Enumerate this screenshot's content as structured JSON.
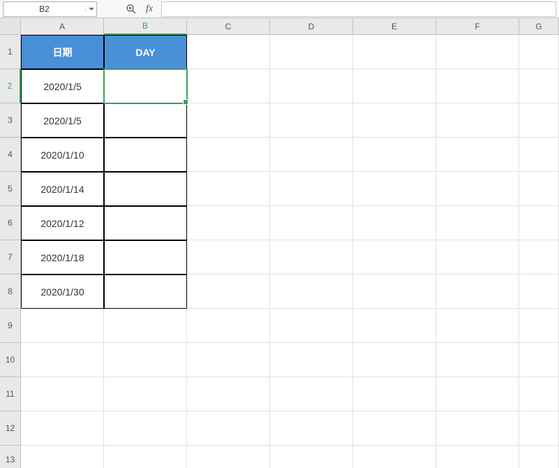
{
  "formula_bar": {
    "cell_ref": "B2",
    "fx_label": "fx",
    "formula_value": ""
  },
  "columns": [
    "A",
    "B",
    "C",
    "D",
    "E",
    "F",
    "G"
  ],
  "row_numbers": [
    "1",
    "2",
    "3",
    "4",
    "5",
    "6",
    "7",
    "8",
    "9",
    "10",
    "11",
    "12",
    "13"
  ],
  "table": {
    "headers": {
      "col_a": "日期",
      "col_b": "DAY"
    },
    "rows": [
      {
        "a": "2020/1/5",
        "b": ""
      },
      {
        "a": "2020/1/5",
        "b": ""
      },
      {
        "a": "2020/1/10",
        "b": ""
      },
      {
        "a": "2020/1/14",
        "b": ""
      },
      {
        "a": "2020/1/12",
        "b": ""
      },
      {
        "a": "2020/1/18",
        "b": ""
      },
      {
        "a": "2020/1/30",
        "b": ""
      }
    ]
  },
  "active_cell": "B2"
}
